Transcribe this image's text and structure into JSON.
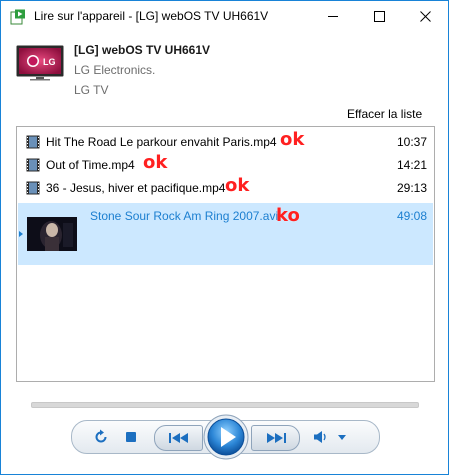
{
  "window": {
    "title": "Lire sur l'appareil - [LG] webOS TV UH661V",
    "minimize_icon": "minimize-icon",
    "maximize_icon": "maximize-icon",
    "close_icon": "close-icon"
  },
  "device": {
    "name": "[LG] webOS TV UH661V",
    "manufacturer": "LG Electronics.",
    "type": "LG TV",
    "logo_text": "LG",
    "icon": "tv-icon"
  },
  "playlist": {
    "clear_label": "Effacer la liste",
    "items": [
      {
        "name": "Hit The Road Le parkour envahit Paris.mp4",
        "duration": "10:37",
        "badge": "ok",
        "icon": "film-icon"
      },
      {
        "name": "Out of Time.mp4",
        "duration": "14:21",
        "badge": "ok",
        "icon": "film-icon"
      },
      {
        "name": "36 - Jesus, hiver et pacifique.mp4",
        "duration": "29:13",
        "badge": "ok",
        "icon": "film-icon"
      },
      {
        "name": "Stone Sour Rock Am Ring 2007.avi",
        "duration": "49:08",
        "badge": "ko",
        "icon": "video-thumbnail"
      }
    ]
  },
  "controls": {
    "repeat": "repeat-icon",
    "stop": "stop-icon",
    "previous": "previous-icon",
    "play": "play-icon",
    "next": "next-icon",
    "volume": "volume-icon",
    "volume_dropdown": "chevron-down-icon"
  },
  "colors": {
    "accent": "#1c7fd0",
    "selection": "#cce8ff",
    "badge": "#ff2020",
    "border": "#1883d7"
  }
}
